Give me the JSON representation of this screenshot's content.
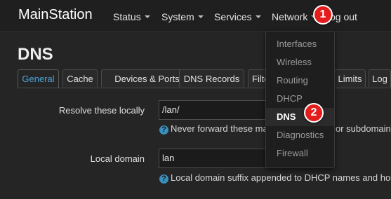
{
  "header": {
    "brand": "MainStation",
    "nav": [
      {
        "label": "Status"
      },
      {
        "label": "System"
      },
      {
        "label": "Services"
      },
      {
        "label": "Network"
      }
    ],
    "logout_label": "og out"
  },
  "page": {
    "title": "DNS",
    "tabs": [
      {
        "label": "General",
        "active": true
      },
      {
        "label": "Cache"
      },
      {
        "label": "Devices & Ports"
      },
      {
        "label": "DNS Records"
      },
      {
        "label": "Filte"
      },
      {
        "label": "Limits"
      },
      {
        "label": "Log"
      }
    ]
  },
  "form": {
    "resolve_locally": {
      "label": "Resolve these locally",
      "value": "/lan/",
      "hint_left": "Never forward these ma",
      "hint_right": "or subdomains"
    },
    "local_domain": {
      "label": "Local domain",
      "value": "lan",
      "hint": "Local domain suffix appended to DHCP names and hos"
    }
  },
  "network_menu": {
    "items": [
      "Interfaces",
      "Wireless",
      "Routing",
      "DHCP",
      "DNS",
      "Diagnostics",
      "Firewall"
    ],
    "active_item": "DNS"
  },
  "annotations": {
    "step1": "1",
    "step2": "2"
  },
  "colors": {
    "accent": "#4aa3d8",
    "marker": "#e41c1c",
    "background": "#252525"
  }
}
